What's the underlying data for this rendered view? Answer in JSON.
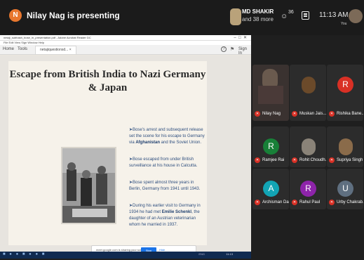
{
  "presenter": {
    "initial": "N",
    "status": "Nilay Nag is presenting"
  },
  "participants": {
    "pinned_name": "MD SHAKIR",
    "more": "and 38 more"
  },
  "topbar": {
    "people_count": "36",
    "time": "11:13 AM",
    "you_label": "You"
  },
  "shared_window": {
    "title": "netaji_subhash_bose_in_presentation.pdf - Adobe Acrobat Reader DC",
    "menu": "File  Edit  View  Sign  Window  Help",
    "tabs": {
      "home": "Home",
      "tools": "Tools",
      "document": "netajiquestionsd... ×"
    },
    "signin": "Sign In",
    "slide": {
      "title": "Escape from British India to Nazi Germany & Japan",
      "bullets": [
        {
          "text": "Bose's arrest and subsequent release set the scene for his escape to Germany via ",
          "highlight": "Afghanistan",
          "tail": " and the Soviet Union."
        },
        {
          "text": "Bose escaped from under British surveillance at his house in Calcutta.",
          "highlight": "",
          "tail": ""
        },
        {
          "text": "Bose spent almost three years in Berlin, Germany from 1941 until 1943.",
          "highlight": "",
          "tail": ""
        },
        {
          "text": "During his earlier visit to Germany in 1934 he had met ",
          "highlight": "Emilie Schenkl",
          "tail": ", the daughter of an Austrian veterinarian whom he married in 1937."
        }
      ]
    },
    "share_bar": {
      "text": "meet.google.com is sharing your screen.",
      "stop": "Stop sharing",
      "hide": "Hide"
    },
    "taskbar": {
      "time": "11:13",
      "tray": "ENG"
    }
  },
  "grid": [
    {
      "name": "Nilay Nag",
      "type": "video",
      "color": "#3a3230"
    },
    {
      "name": "Muskan Jais...",
      "type": "photo",
      "color": "#6b4a2a"
    },
    {
      "name": "Rishika Bane...",
      "type": "initial",
      "initial": "R",
      "color": "#d93025"
    },
    {
      "name": "Ramjee Rai",
      "type": "initial",
      "initial": "R",
      "color": "#188038"
    },
    {
      "name": "Rohit Choudh...",
      "type": "photo",
      "color": "#8a8378"
    },
    {
      "name": "Supriya Singh",
      "type": "photo",
      "color": "#8a6b4a"
    },
    {
      "name": "Archisman Das",
      "type": "initial",
      "initial": "A",
      "color": "#12a4b4"
    },
    {
      "name": "Rahul Paul",
      "type": "initial",
      "initial": "R",
      "color": "#8e24aa"
    },
    {
      "name": "Urby Chakrab...",
      "type": "initial",
      "initial": "U",
      "color": "#5f6f80"
    }
  ]
}
